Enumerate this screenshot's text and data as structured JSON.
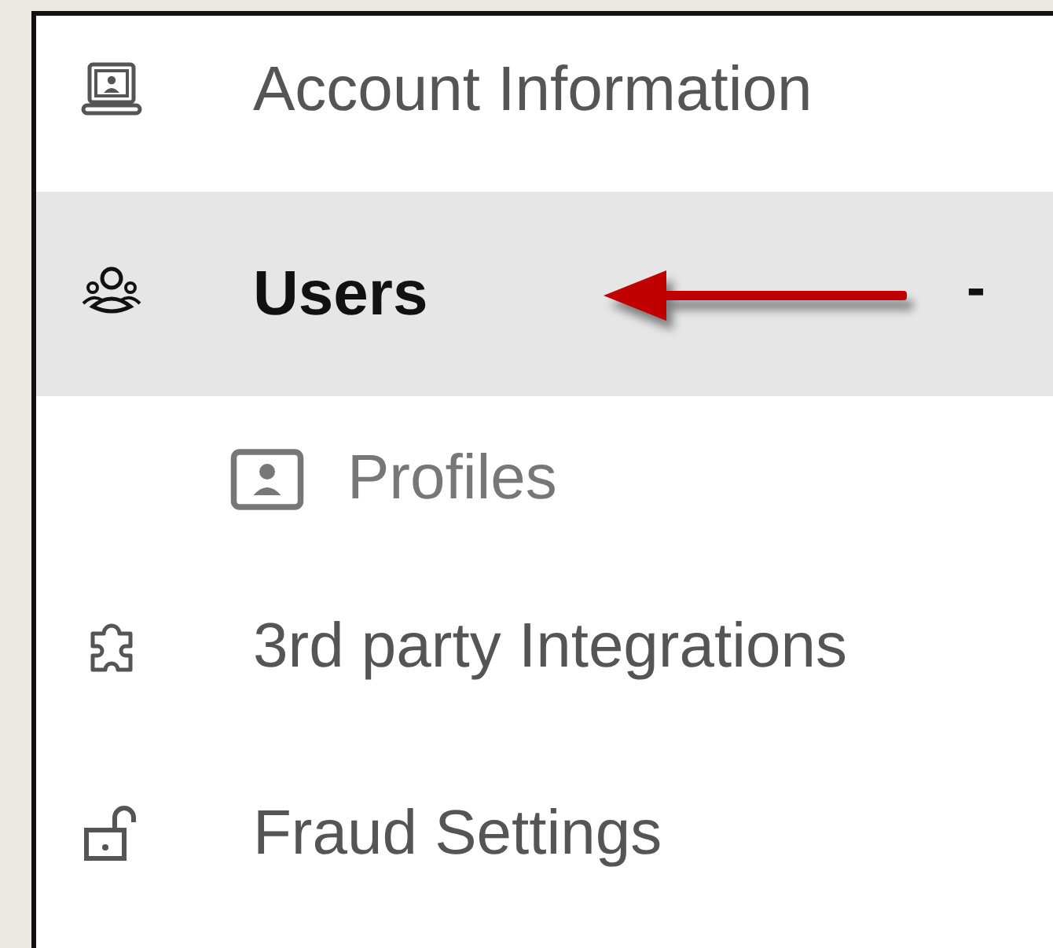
{
  "menu": {
    "items": [
      {
        "label": "Account Information",
        "selected": false,
        "annotated": false
      },
      {
        "label": "Users",
        "selected": true,
        "annotated": true,
        "toggle": "-",
        "children": [
          {
            "label": "Profiles",
            "selected": false,
            "annotated": false
          }
        ]
      },
      {
        "label": "3rd party Integrations",
        "selected": false,
        "annotated": false
      },
      {
        "label": "Fraud Settings",
        "selected": false,
        "annotated": false
      }
    ]
  }
}
